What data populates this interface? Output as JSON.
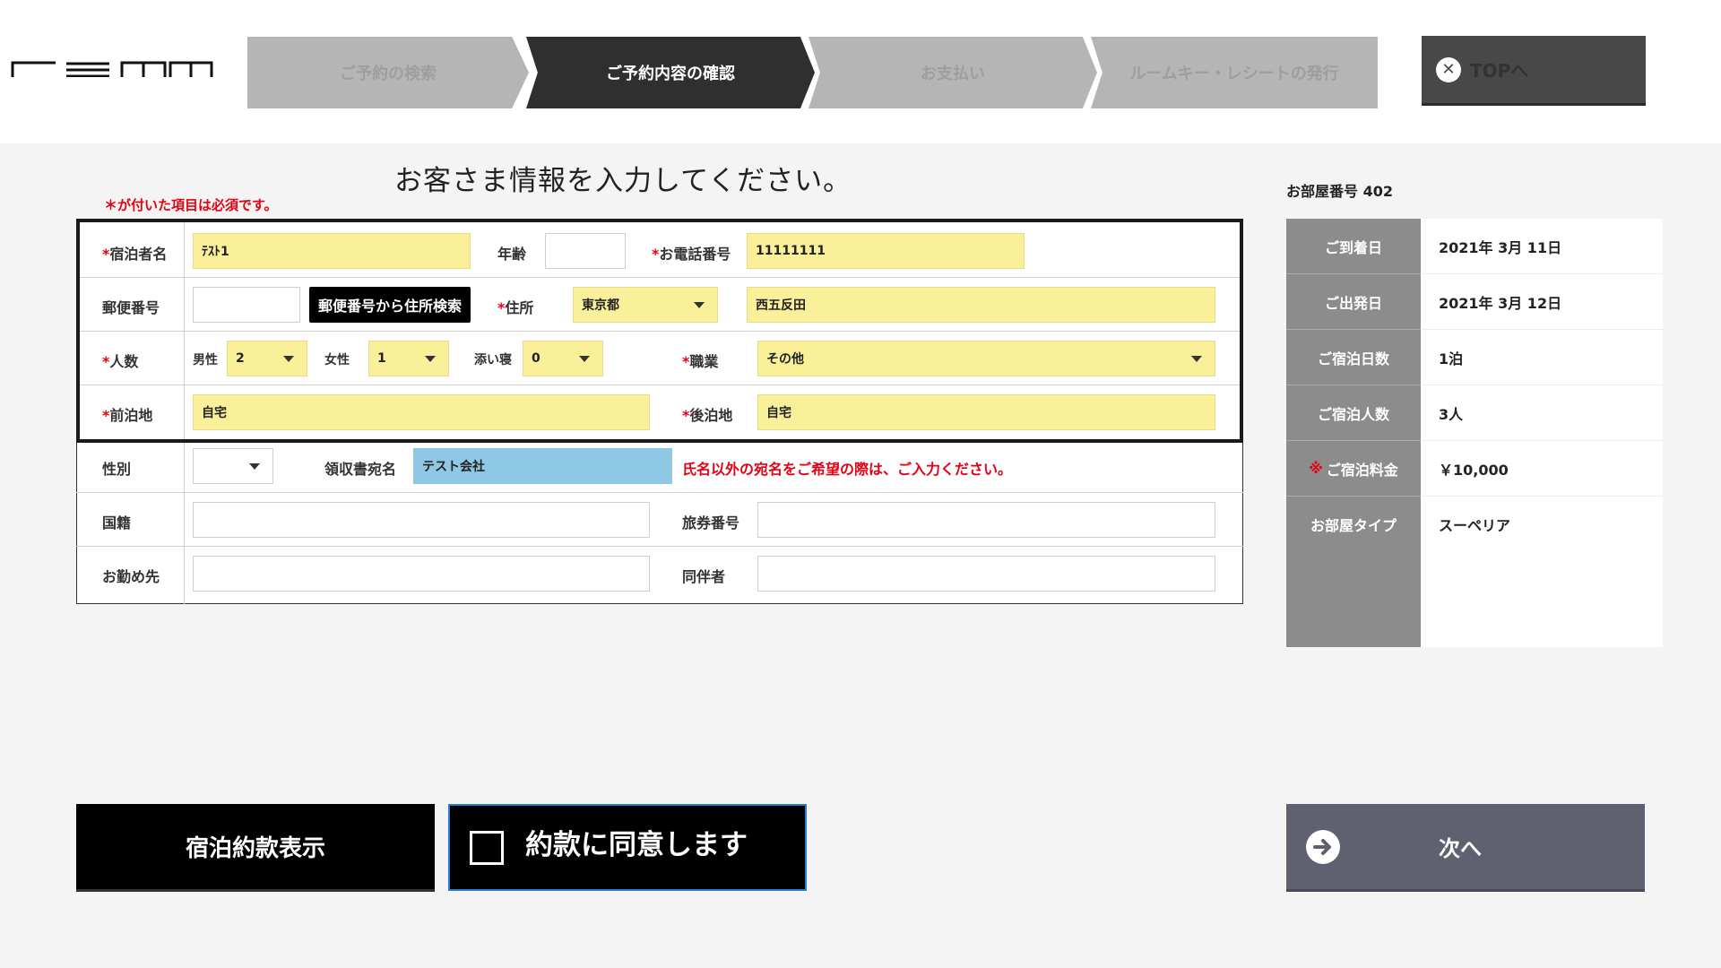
{
  "steps": [
    {
      "label": "ご予約の検索",
      "active": false
    },
    {
      "label": "ご予約内容の確認",
      "active": true
    },
    {
      "label": "お支払い",
      "active": false
    },
    {
      "label": "ルームキー・レシートの発行",
      "active": false
    }
  ],
  "top_button": {
    "label": "TOPへ",
    "icon": "close-circle-icon"
  },
  "title": "お客さま情報を入力してください。",
  "required_note": "＊が付いた項目は必須です。",
  "form": {
    "guest_name": {
      "label": "宿泊者名",
      "value": "ﾃｽﾄ1",
      "required": true
    },
    "age": {
      "label": "年齢",
      "value": ""
    },
    "phone": {
      "label": "お電話番号",
      "value": "11111111",
      "required": true
    },
    "zip": {
      "label": "郵便番号",
      "value": "",
      "search_button": "郵便番号から住所検索"
    },
    "address": {
      "label": "住所",
      "prefecture": "東京都",
      "value": "西五反田",
      "required": true
    },
    "people": {
      "label": "人数",
      "required": true,
      "male_label": "男性",
      "male": "2",
      "female_label": "女性",
      "female": "1",
      "cosleep_label": "添い寝",
      "cosleep": "0"
    },
    "occupation": {
      "label": "職業",
      "value": "その他",
      "required": true
    },
    "prev_stay": {
      "label": "前泊地",
      "value": "自宅",
      "required": true
    },
    "next_stay": {
      "label": "後泊地",
      "value": "自宅",
      "required": true
    },
    "gender": {
      "label": "性別",
      "value": ""
    },
    "receipt": {
      "label": "領収書宛名",
      "value": "テスト会社",
      "note": "氏名以外の宛名をご希望の際は、ご入力ください。"
    },
    "nationality": {
      "label": "国籍",
      "value": ""
    },
    "passport": {
      "label": "旅券番号",
      "value": ""
    },
    "workplace": {
      "label": "お勤め先",
      "value": ""
    },
    "companion": {
      "label": "同伴者",
      "value": ""
    }
  },
  "room": {
    "number_label": "お部屋番号 402",
    "rows": [
      {
        "label": "ご到着日",
        "value": "2021年 3月 11日"
      },
      {
        "label": "ご出発日",
        "value": "2021年 3月 12日"
      },
      {
        "label": "ご宿泊日数",
        "value": "1泊"
      },
      {
        "label": "ご宿泊人数",
        "value": "3人"
      },
      {
        "label_mark": "※",
        "label": "ご宿泊料金",
        "value": "￥10,000"
      },
      {
        "label": "お部屋タイプ",
        "value": "スーペリア"
      }
    ]
  },
  "buttons": {
    "terms": "宿泊約款表示",
    "agree": "約款に同意します",
    "agree_checked": false,
    "next": "次へ"
  },
  "colors": {
    "required_field": "#fbf09a",
    "receipt_field": "#8ec8e4",
    "required_text": "#e50012",
    "active_step": "#2f2f2f",
    "next_button": "#5f6070"
  }
}
